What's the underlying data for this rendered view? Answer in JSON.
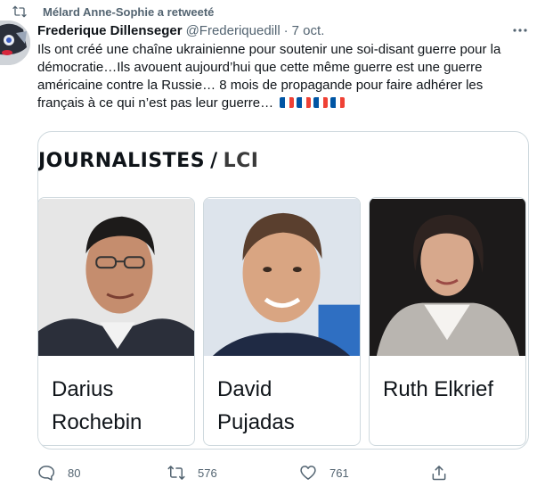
{
  "retweet": {
    "label": "Mélard Anne-Sophie a retweeté"
  },
  "tweet": {
    "author_name": "Frederique Dillenseger",
    "author_handle": "@Frederiquedill",
    "separator": "·",
    "date": "7 oct.",
    "text": "Ils ont créé une chaîne ukrainienne pour soutenir une soi-disant guerre pour la démocratie…Ils avouent aujourd’hui que cette même guerre est une guerre américaine contre la Russie… 8 mois de propagande pour faire adhérer les français à ce qui n’est pas leur guerre…",
    "flag_colors": [
      "#0055a4",
      "#ffffff",
      "#ef4135"
    ]
  },
  "card": {
    "title": "JOURNALISTES",
    "slash": "/",
    "brand": "LCI",
    "people": [
      {
        "name_line1": "Darius",
        "name_line2": "Rochebin"
      },
      {
        "name_line1": "David",
        "name_line2": "Pujadas"
      },
      {
        "name_line1": "Ruth Elkrief",
        "name_line2": ""
      }
    ]
  },
  "actions": {
    "replies": "80",
    "retweets": "576",
    "likes": "761"
  },
  "colors": {
    "text": "#0f1419",
    "muted": "#536471",
    "border": "#cfd9de"
  }
}
